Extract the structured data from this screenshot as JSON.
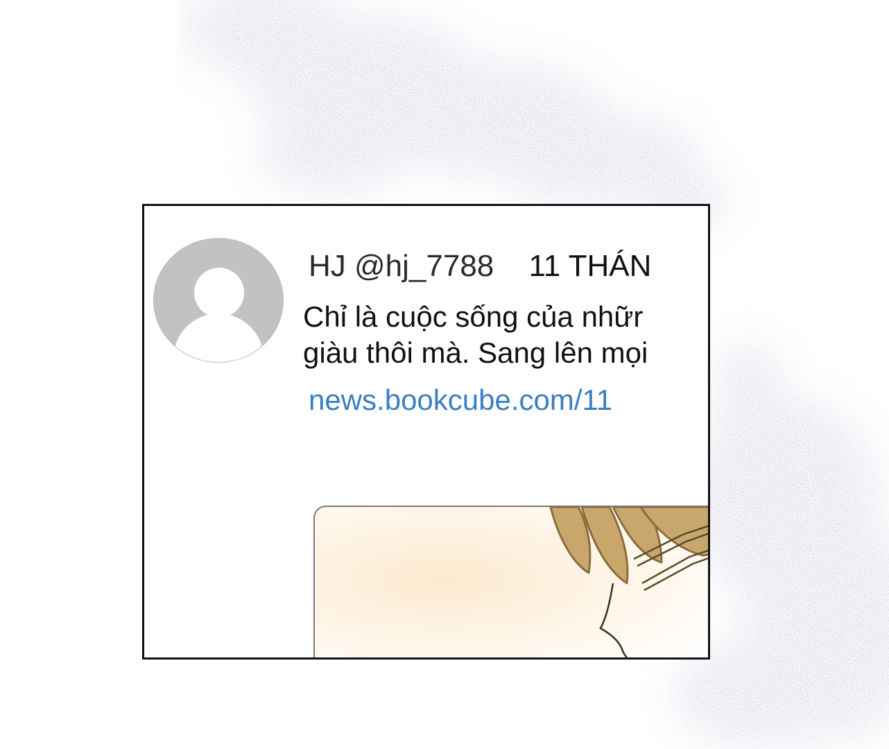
{
  "tweet": {
    "handle": "HJ @hj_7788",
    "date": "11 THÁN",
    "line1": "Chỉ là cuộc sống của nhữr",
    "line2": "giàu thôi mà. Sang lên mọi",
    "link": "news.bookcube.com/11"
  },
  "icons": {
    "avatar": "default-user-avatar-icon"
  },
  "colors": {
    "link": "#3b7fc0",
    "texture": "#7d7aa3",
    "avatar": "#c2c2c2"
  }
}
